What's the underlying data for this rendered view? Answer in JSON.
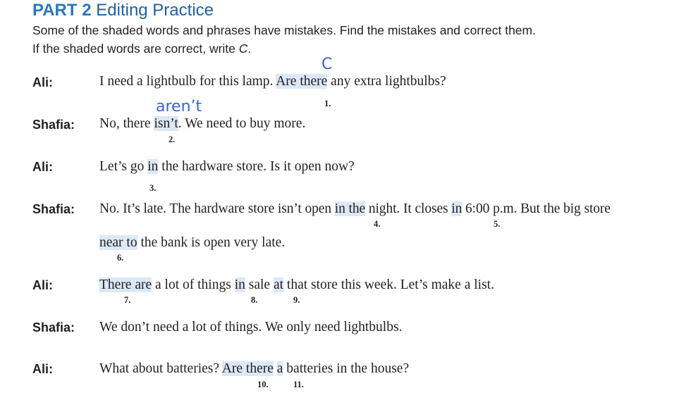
{
  "header": {
    "part": "PART 2",
    "title": "Editing Practice",
    "instructions_line1": "Some of the shaded words and phrases have mistakes. Find the mistakes and correct them.",
    "instructions_line2_prefix": "If the shaded words are correct, write ",
    "instructions_line2_letter": "C",
    "instructions_line2_suffix": "."
  },
  "handwritten": {
    "answer1": "C",
    "answer2": "aren’t"
  },
  "dialogue": [
    {
      "speaker": "Ali:",
      "parts": [
        "I need a lightbulb for this lamp. ",
        "Are there",
        " any extra lightbulbs?"
      ],
      "numbers": [
        "1."
      ]
    },
    {
      "speaker": "Shafia:",
      "parts": [
        "No, there ",
        "isn’t",
        ". We need to buy more."
      ],
      "numbers": [
        "2."
      ]
    },
    {
      "speaker": "Ali:",
      "parts": [
        "Let’s go ",
        "in",
        " the hardware store. Is it open now?"
      ],
      "numbers": [
        "3."
      ]
    },
    {
      "speaker": "Shafia:",
      "parts": [
        "No. It’s late. The hardware store isn’t open ",
        "in the",
        " night. It closes ",
        "in",
        " 6:00 p.m. But the big store"
      ],
      "parts2": [
        "near to",
        " the bank is open very late."
      ],
      "numbers": [
        "4.",
        "5.",
        "6."
      ]
    },
    {
      "speaker": "Ali:",
      "parts": [
        "There are",
        " a lot of things ",
        "in",
        " sale ",
        "at",
        " that store this week. Let’s make a list."
      ],
      "numbers": [
        "7.",
        "8.",
        "9."
      ]
    },
    {
      "speaker": "Shafia:",
      "parts": [
        "We don’t need a lot of things. We only need lightbulbs."
      ]
    },
    {
      "speaker": "Ali:",
      "parts": [
        "What about batteries? ",
        "Are there",
        " ",
        "a",
        " batteries in the house?"
      ],
      "numbers": [
        "10.",
        "11."
      ]
    }
  ]
}
